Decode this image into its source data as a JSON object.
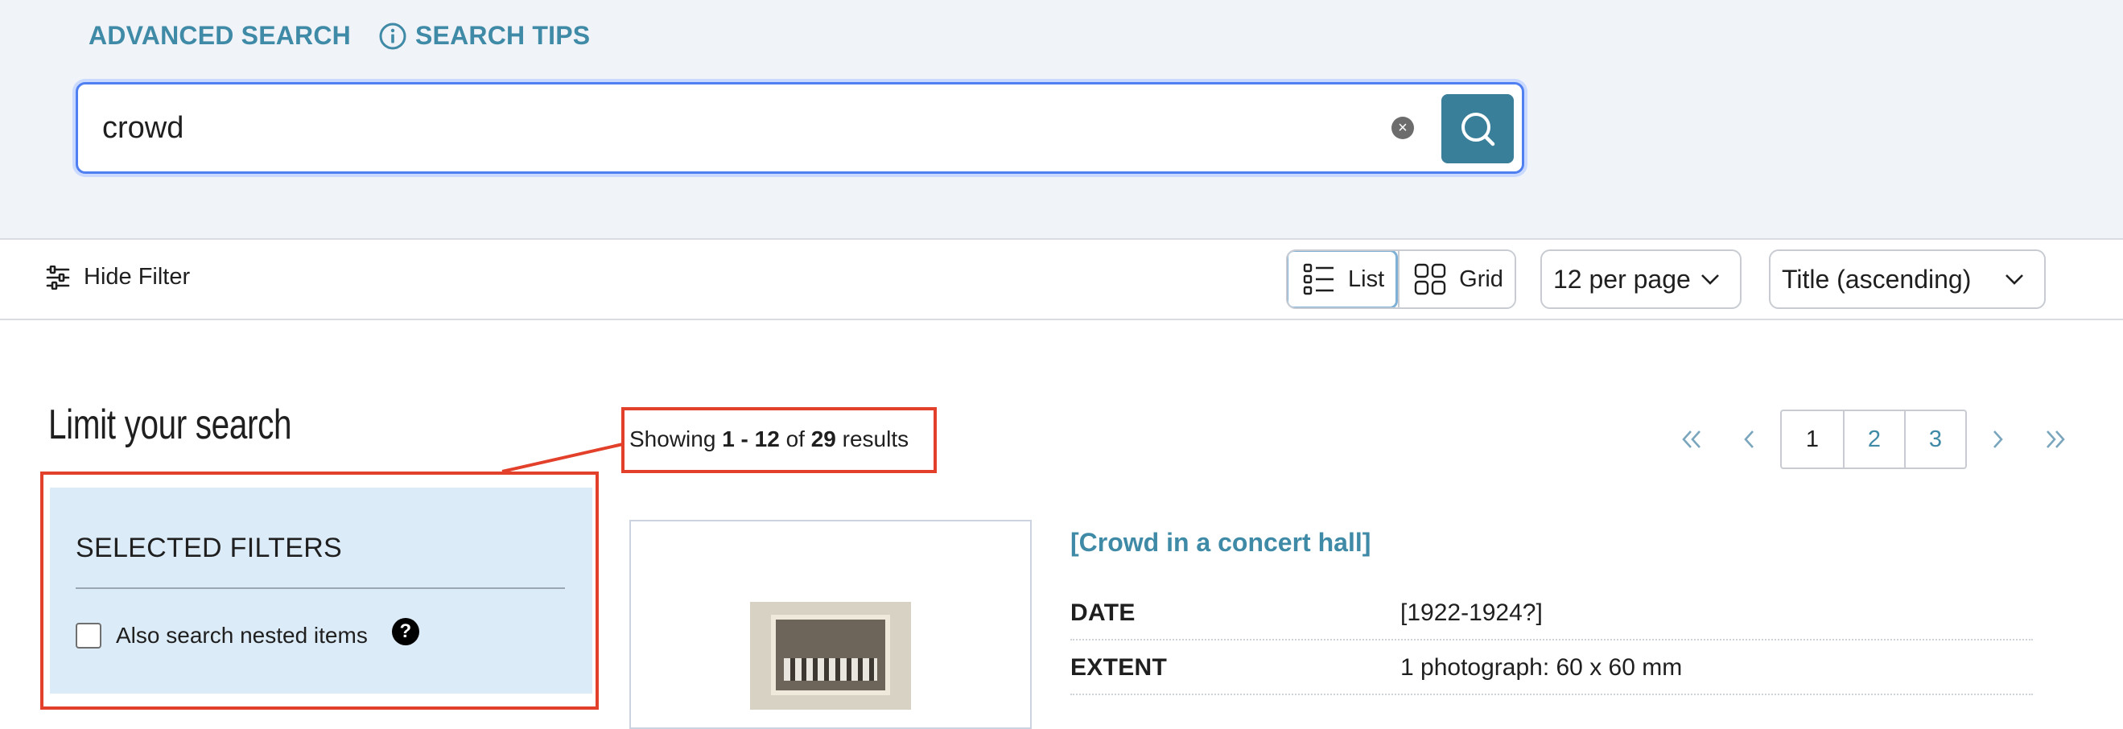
{
  "search_links": {
    "advanced": "ADVANCED SEARCH",
    "tips": "SEARCH TIPS"
  },
  "search": {
    "query": "crowd",
    "clear_symbol": "×"
  },
  "toolbar": {
    "hide_filter": "Hide Filter",
    "view_list": "List",
    "view_grid": "Grid",
    "active_view": "List",
    "per_page": "12 per page",
    "sort": "Title (ascending)"
  },
  "sidebar": {
    "title": "Limit your search",
    "filters_heading": "SELECTED FILTERS",
    "nested_label": "Also search nested items",
    "nested_checked": false,
    "help_symbol": "?"
  },
  "results": {
    "prefix": "Showing ",
    "range": "1 - 12",
    "of": " of ",
    "total": "29",
    "suffix": " results"
  },
  "pagination": {
    "pages": [
      "1",
      "2",
      "3"
    ],
    "current": "1"
  },
  "record": {
    "title": "[Crowd in a concert hall]",
    "fields": [
      {
        "label": "DATE",
        "value": "[1922-1924?]"
      },
      {
        "label": "EXTENT",
        "value": "1 photograph: 60 x 60 mm"
      }
    ]
  },
  "colors": {
    "accent": "#3f8aa6",
    "search_button": "#3a7f99",
    "annotation_red": "#e2402a",
    "filter_panel_bg": "#dcebf8",
    "search_band_bg": "#f0f3f8"
  }
}
